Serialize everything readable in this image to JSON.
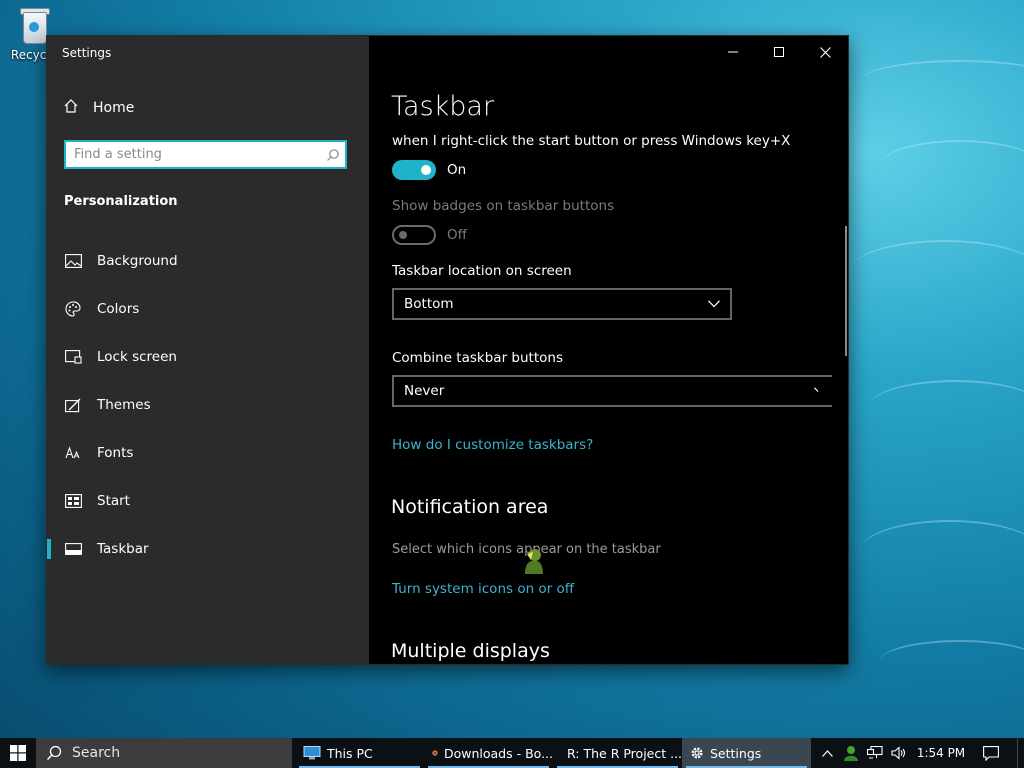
{
  "desktop": {
    "recycle_bin_label": "Recycle"
  },
  "window": {
    "title": "Settings",
    "controls": {
      "minimize": "minimize",
      "maximize": "maximize",
      "close": "close"
    }
  },
  "sidebar": {
    "home_label": "Home",
    "search_placeholder": "Find a setting",
    "section_title": "Personalization",
    "items": [
      {
        "label": "Background",
        "icon": "picture-icon"
      },
      {
        "label": "Colors",
        "icon": "palette-icon"
      },
      {
        "label": "Lock screen",
        "icon": "lock-screen-icon"
      },
      {
        "label": "Themes",
        "icon": "themes-icon"
      },
      {
        "label": "Fonts",
        "icon": "fonts-icon"
      },
      {
        "label": "Start",
        "icon": "start-icon"
      },
      {
        "label": "Taskbar",
        "icon": "taskbar-icon",
        "active": true
      }
    ]
  },
  "content": {
    "page_title": "Taskbar",
    "powershell_desc": "when I right-click the start button or press Windows key+X",
    "toggle1_state": "On",
    "badges_label": "Show badges on taskbar buttons",
    "toggle2_state": "Off",
    "location_label": "Taskbar location on screen",
    "location_value": "Bottom",
    "combine_label": "Combine taskbar buttons",
    "combine_value": "Never",
    "customize_link": "How do I customize taskbars?",
    "notification_title": "Notification area",
    "select_icons_text": "Select which icons appear on the taskbar",
    "system_icons_link": "Turn system icons on or off",
    "multiple_displays_title": "Multiple displays"
  },
  "taskbar": {
    "search_label": "Search",
    "apps": [
      {
        "label": "This PC",
        "icon": "computer-icon"
      },
      {
        "label": "Downloads - Bo...",
        "icon": "firefox-icon"
      },
      {
        "label": "R: The R Project ...",
        "icon": "chrome-icon"
      },
      {
        "label": "Settings",
        "icon": "gear-icon",
        "active": true
      }
    ],
    "clock": "1:54 PM"
  },
  "colors": {
    "accent": "#1fb2c9",
    "link": "#3bb3cf",
    "sidebar_bg": "#2b2b2b",
    "content_bg": "#000000"
  }
}
